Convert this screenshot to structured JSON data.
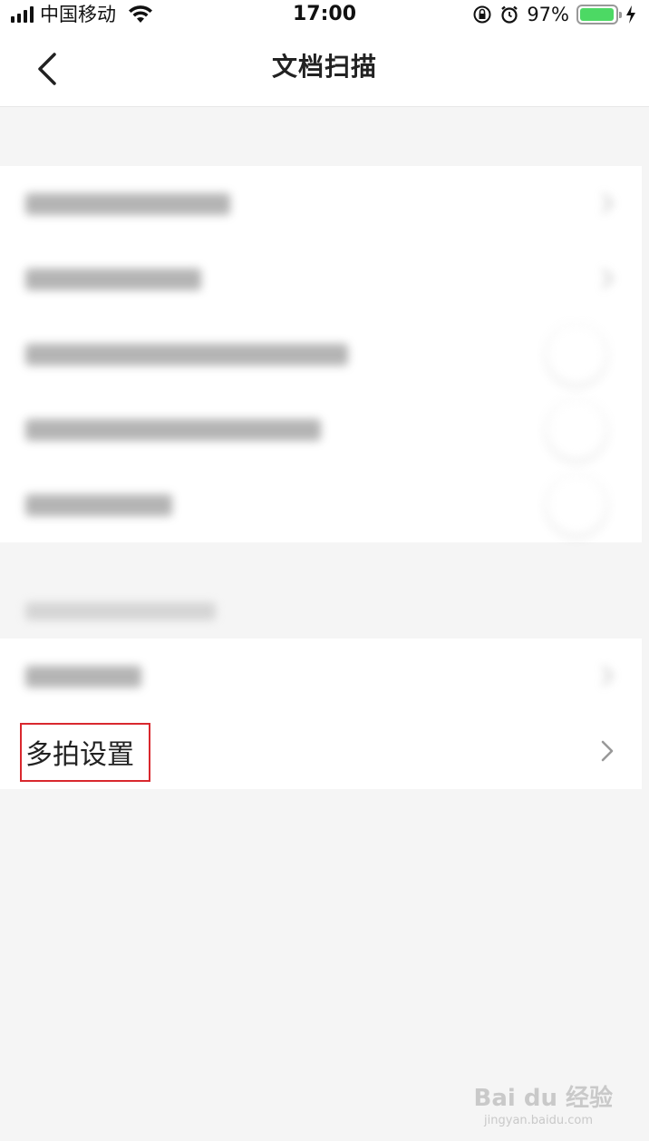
{
  "status_bar": {
    "carrier": "中国移动",
    "time": "17:00",
    "battery_percent": "97%",
    "battery_level": 0.97,
    "icons": [
      "signal-icon",
      "wifi-icon",
      "orientation-lock-icon",
      "alarm-icon",
      "battery-icon",
      "charging-icon"
    ]
  },
  "nav": {
    "title": "文档扫描",
    "back_icon": "chevron-left-icon"
  },
  "groups": [
    {
      "rows": [
        {
          "label": "",
          "control": "chevron"
        },
        {
          "label": "",
          "control": "chevron"
        },
        {
          "label": "",
          "control": "toggle"
        },
        {
          "label": "",
          "control": "toggle"
        },
        {
          "label": "",
          "control": "toggle"
        }
      ]
    },
    {
      "caption": "",
      "rows": [
        {
          "label": "",
          "control": "chevron"
        },
        {
          "label": "多拍设置",
          "control": "chevron",
          "highlighted": true
        }
      ]
    }
  ],
  "watermark": {
    "text": "Bai du 经验",
    "sub": "jingyan.baidu.com"
  }
}
